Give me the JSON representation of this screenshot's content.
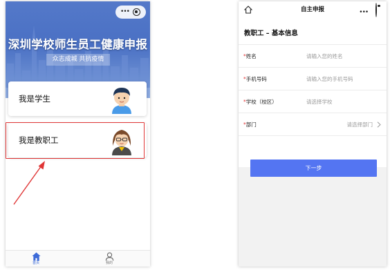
{
  "left_screen": {
    "title": "深圳学校师生员工健康申报",
    "subtitle": "众志成城 共抗疫情",
    "options": [
      {
        "label": "我是学生",
        "avatar": "student-boy-icon"
      },
      {
        "label": "我是教职工",
        "avatar": "teacher-woman-icon"
      }
    ],
    "tabbar": {
      "home_label": "首页",
      "mine_label": "我的"
    },
    "capsule_icons": [
      "more-dots-icon",
      "close-target-icon"
    ],
    "colors": {
      "hero_blue": "#4a70c4",
      "highlight_red": "#e03535",
      "tab_active": "#3d6bd8"
    }
  },
  "right_screen": {
    "nav_title": "自主申报",
    "section_title": "教职工 – 基本信息",
    "fields": [
      {
        "label": "姓名",
        "placeholder": "请输入您的姓名"
      },
      {
        "label": "手机号码",
        "placeholder": "请输入您的手机号码"
      },
      {
        "label": "学校（校区）",
        "placeholder": "请选择学校"
      },
      {
        "label": "部门",
        "placeholder": "请选择部门"
      }
    ],
    "required_mark": "*",
    "next_button": "下一步",
    "colors": {
      "button_blue": "#5475f2",
      "required_red": "#e23838"
    }
  }
}
